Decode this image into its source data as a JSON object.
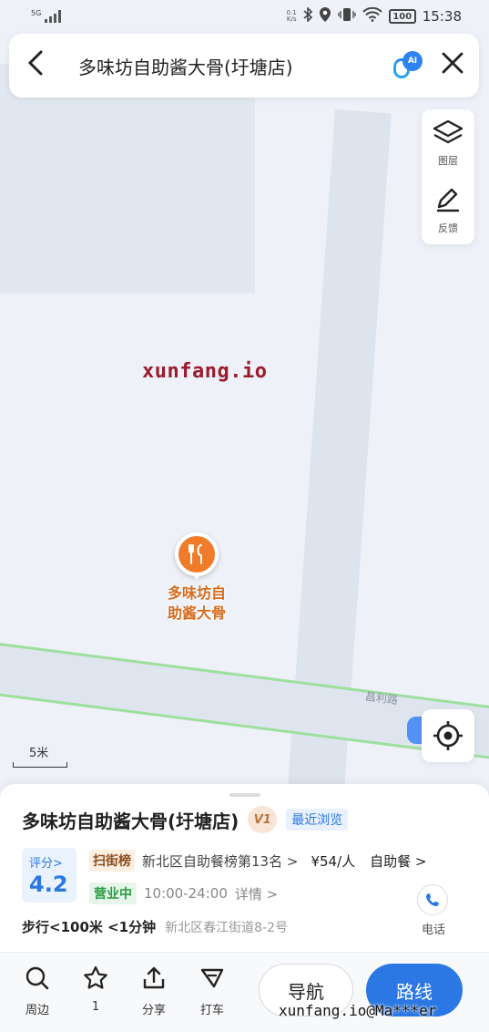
{
  "status_bar": {
    "network": "5G",
    "speed_value": "0.1",
    "speed_unit": "K/s",
    "battery": "100",
    "time": "15:38"
  },
  "search": {
    "title": "多味坊自助酱大骨(圩塘店)",
    "ai_badge": "AI"
  },
  "tools": {
    "layers_label": "图层",
    "feedback_label": "反馈"
  },
  "map": {
    "watermark": "xunfang.io",
    "poi_label_line1": "多味坊自",
    "poi_label_line2": "助酱大骨",
    "road_name": "昌利路",
    "scale": "5米"
  },
  "place": {
    "name": "多味坊自助酱大骨(圩塘店)",
    "level_badge": "V1",
    "recent_tag": "最近浏览",
    "score_label": "评分>",
    "score_value": "4.2",
    "rank_tag": "扫街榜",
    "rank_text": "新北区自助餐榜第13名 >",
    "price": "¥54/人",
    "cuisine": "自助餐 >",
    "status": "营业中",
    "hours": "10:00-24:00",
    "detail": "详情 >",
    "walk": "步行<100米 <1分钟",
    "address": "新北区春江街道8-2号",
    "phone_label": "电话"
  },
  "toolbar": {
    "nearby": "周边",
    "favorite": "1",
    "share": "分享",
    "taxi": "打车",
    "navigate": "导航",
    "route": "路线"
  },
  "footer_watermark": "xunfang.io@Ma***er",
  "colors": {
    "accent": "#2b78e4",
    "poi_orange": "#f07c2a",
    "road_green": "#9de09d"
  }
}
